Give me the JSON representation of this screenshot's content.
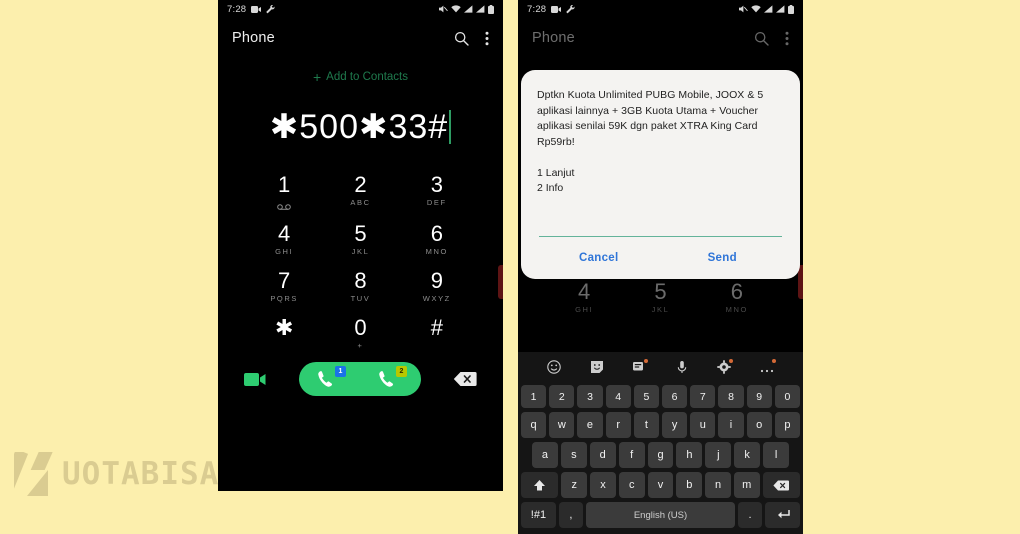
{
  "theme": {
    "page_bg": "#fcefad",
    "phone_bg": "#000000",
    "accent_green": "#2ecc71",
    "link_green": "#1f7a4d",
    "dialog_bg": "#f4f3f1",
    "dialog_link": "#2f75d8",
    "field_underline": "#63b39a",
    "sim1_badge": "#1a73e8",
    "sim2_badge": "#b8c800",
    "power_button": "#5e1414"
  },
  "watermark": {
    "text": "UOTABISA.COM",
    "logo": "k-logo-icon"
  },
  "status_bar": {
    "time": "7:28",
    "left_icons": [
      "video-camera-icon",
      "wrench-icon"
    ],
    "right_icons": [
      "volume-muted-icon",
      "wifi-icon",
      "signal-1-icon",
      "signal-2-icon",
      "battery-icon"
    ]
  },
  "app_bar": {
    "title": "Phone",
    "search_icon": "search-icon",
    "overflow_icon": "more-vertical-icon"
  },
  "dialer": {
    "add_to_contacts": "Add to Contacts",
    "plus": "+",
    "number": "✱500✱33#",
    "keys": [
      {
        "digit": "1",
        "sub": "",
        "icon": "voicemail-icon"
      },
      {
        "digit": "2",
        "sub": "ABC",
        "icon": ""
      },
      {
        "digit": "3",
        "sub": "DEF",
        "icon": ""
      },
      {
        "digit": "4",
        "sub": "GHI",
        "icon": ""
      },
      {
        "digit": "5",
        "sub": "JKL",
        "icon": ""
      },
      {
        "digit": "6",
        "sub": "MNO",
        "icon": ""
      },
      {
        "digit": "7",
        "sub": "PQRS",
        "icon": ""
      },
      {
        "digit": "8",
        "sub": "TUV",
        "icon": ""
      },
      {
        "digit": "9",
        "sub": "WXYZ",
        "icon": ""
      },
      {
        "digit": "✱",
        "sub": "",
        "icon": ""
      },
      {
        "digit": "0",
        "sub": "+",
        "icon": ""
      },
      {
        "digit": "#",
        "sub": "",
        "icon": ""
      }
    ],
    "action_bar": {
      "video_call_icon": "video-call-icon",
      "call_sim1_label": "1",
      "call_sim2_label": "2",
      "backspace_icon": "backspace-icon"
    }
  },
  "ussd_dialog": {
    "message": "Dptkn Kuota Unlimited PUBG Mobile, JOOX & 5 aplikasi lainnya + 3GB Kuota Utama + Voucher aplikasi senilai 59K dgn paket XTRA King Card Rp59rb!",
    "options": [
      "1 Lanjut",
      "2 Info"
    ],
    "input_value": "",
    "input_placeholder": "",
    "cancel_label": "Cancel",
    "send_label": "Send"
  },
  "keyboard": {
    "toolbar_icons": [
      "emoji-icon",
      "sticker-icon",
      "gif-clipboard-icon",
      "microphone-icon",
      "settings-gear-icon",
      "more-horizontal-icon"
    ],
    "number_row": [
      "1",
      "2",
      "3",
      "4",
      "5",
      "6",
      "7",
      "8",
      "9",
      "0"
    ],
    "row1": [
      "q",
      "w",
      "e",
      "r",
      "t",
      "y",
      "u",
      "i",
      "o",
      "p"
    ],
    "row2": [
      "a",
      "s",
      "d",
      "f",
      "g",
      "h",
      "j",
      "k",
      "l"
    ],
    "row3": [
      "z",
      "x",
      "c",
      "v",
      "b",
      "n",
      "m"
    ],
    "shift_icon": "shift-up-icon",
    "backspace_icon": "backspace-icon",
    "symbols_label": "!#1",
    "comma_label": ",",
    "space_label": "English (US)",
    "period_label": ".",
    "enter_icon": "enter-return-icon"
  }
}
